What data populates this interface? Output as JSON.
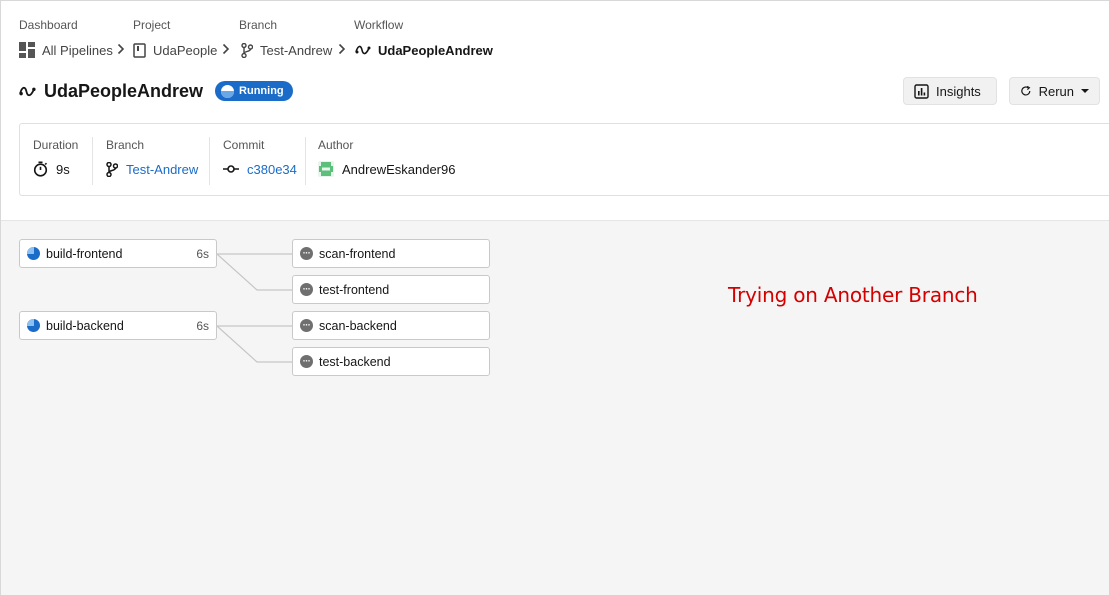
{
  "breadcrumb": {
    "labels": {
      "dashboard": "Dashboard",
      "project": "Project",
      "branch": "Branch",
      "workflow": "Workflow"
    },
    "items": {
      "pipelines": "All Pipelines",
      "project": "UdaPeople",
      "branch": "Test-Andrew",
      "workflow": "UdaPeopleAndrew"
    }
  },
  "header": {
    "title": "UdaPeopleAndrew",
    "status": "Running",
    "insights_label": "Insights",
    "rerun_label": "Rerun"
  },
  "meta": {
    "duration": {
      "label": "Duration",
      "value": "9s"
    },
    "branch": {
      "label": "Branch",
      "value": "Test-Andrew"
    },
    "commit": {
      "label": "Commit",
      "value": "c380e34"
    },
    "author": {
      "label": "Author",
      "value": "AndrewEskander96"
    }
  },
  "jobs": {
    "build_frontend": {
      "name": "build-frontend",
      "duration": "6s",
      "status": "running"
    },
    "scan_frontend": {
      "name": "scan-frontend",
      "status": "queued"
    },
    "test_frontend": {
      "name": "test-frontend",
      "status": "queued"
    },
    "build_backend": {
      "name": "build-backend",
      "duration": "6s",
      "status": "running"
    },
    "scan_backend": {
      "name": "scan-backend",
      "status": "queued"
    },
    "test_backend": {
      "name": "test-backend",
      "status": "queued"
    }
  },
  "annotation": "Trying on Another Branch",
  "colors": {
    "accent": "#1b6cc8",
    "annotation": "#d40000",
    "queued": "#6f6f6f"
  }
}
